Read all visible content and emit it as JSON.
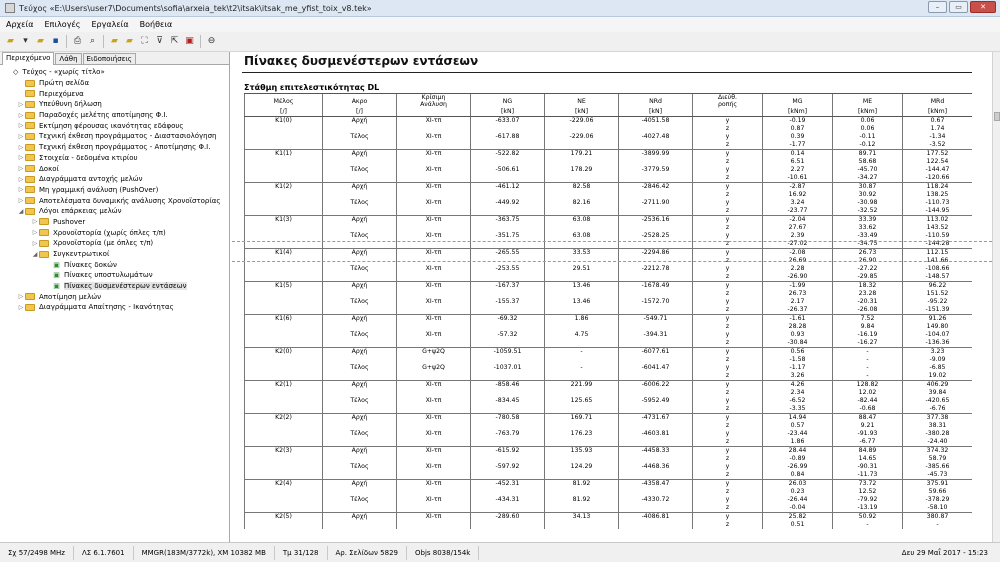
{
  "title": "Τεύχος «E:\\Users\\user7\\Documents\\sofia\\arxeia_tek\\t2\\itsak\\itsak_me_yfist_toix_v8.tek»",
  "menu": [
    "Αρχεία",
    "Επιλογές",
    "Εργαλεία",
    "Βοήθεια"
  ],
  "tabs": [
    "Περιεχόμενο",
    "Λάθη",
    "Ειδοποιήσεις"
  ],
  "tree": [
    {
      "label": "Τεύχος - «χωρίς τίτλο»",
      "icon": "diamond-icon",
      "depth": 0,
      "arrow": ""
    },
    {
      "label": "Πρώτη σελίδα",
      "icon": "folder-icon",
      "depth": 1,
      "arrow": ""
    },
    {
      "label": "Περιεχόμενα",
      "icon": "folder-icon",
      "depth": 1,
      "arrow": ""
    },
    {
      "label": "Υπεύθυνη δήλωση",
      "icon": "folder-icon",
      "depth": 1,
      "arrow": "▷"
    },
    {
      "label": "Παραδοχές μελέτης αποτίμησης Φ.Ι.",
      "icon": "folder-icon",
      "depth": 1,
      "arrow": "▷"
    },
    {
      "label": "Εκτίμηση φέρουσας ικανότητας εδάφους",
      "icon": "folder-icon",
      "depth": 1,
      "arrow": "▷"
    },
    {
      "label": "Τεχνική έκθεση προγράμματος - Διαστασιολόγηση",
      "icon": "folder-icon",
      "depth": 1,
      "arrow": "▷"
    },
    {
      "label": "Τεχνική έκθεση προγράμματος - Αποτίμησης Φ.Ι.",
      "icon": "folder-icon",
      "depth": 1,
      "arrow": "▷"
    },
    {
      "label": "Στοιχεία - δεδομένα κτιρίου",
      "icon": "folder-icon",
      "depth": 1,
      "arrow": "▷"
    },
    {
      "label": "Δοκοί",
      "icon": "folder-icon",
      "depth": 1,
      "arrow": "▷"
    },
    {
      "label": "Διαγράμματα αντοχής μελών",
      "icon": "folder-icon",
      "depth": 1,
      "arrow": "▷"
    },
    {
      "label": "Μη γραμμική ανάλυση (PushOver)",
      "icon": "folder-icon",
      "depth": 1,
      "arrow": "▷"
    },
    {
      "label": "Αποτελέσματα δυναμικής ανάλυσης Χρονοϊστορίας",
      "icon": "folder-icon",
      "depth": 1,
      "arrow": "▷"
    },
    {
      "label": "Λόγοι επάρκειας μελών",
      "icon": "folder-icon",
      "depth": 1,
      "arrow": "◢"
    },
    {
      "label": "Pushover",
      "icon": "folder-icon",
      "depth": 2,
      "arrow": "▷"
    },
    {
      "label": "Χρονοϊστορία (χωρίς όπλες τ/π)",
      "icon": "folder-icon",
      "depth": 2,
      "arrow": "▷"
    },
    {
      "label": "Χρονοϊστορία (με όπλες τ/π)",
      "icon": "folder-icon",
      "depth": 2,
      "arrow": "▷"
    },
    {
      "label": "Συγκεντρωτικοί",
      "icon": "folder-icon",
      "depth": 2,
      "arrow": "◢"
    },
    {
      "label": "Πίνακες δοκών",
      "icon": "page-icon",
      "depth": 3,
      "arrow": ""
    },
    {
      "label": "Πίνακες υποστυλωμάτων",
      "icon": "page-icon",
      "depth": 3,
      "arrow": ""
    },
    {
      "label": "Πίνακες δυσμενέστερων εντάσεων",
      "icon": "page-icon",
      "depth": 3,
      "arrow": "",
      "selected": true
    },
    {
      "label": "Αποτίμηση μελών",
      "icon": "folder-icon",
      "depth": 1,
      "arrow": "▷"
    },
    {
      "label": "Διαγράμματα Απαίτησης - Ικανότητας",
      "icon": "folder-icon",
      "depth": 1,
      "arrow": "▷"
    }
  ],
  "page": {
    "title": "Πίνακες δυσμενέστερων εντάσεων",
    "subtitle": "Στάθμη επιτελεστικότητας DL"
  },
  "table": {
    "headers": [
      "Μέλος",
      "Ακρο",
      "Κρίσιμη\nΑνάλυση",
      "NG",
      "NE",
      "NRd",
      "Διεύθ.\nροπής",
      "MG",
      "ME",
      "MRd"
    ],
    "units": [
      "[/]",
      "[/]",
      "",
      "[kN]",
      "[kN]",
      "[kN]",
      "",
      "[kNm]",
      "[kNm]",
      "[kNm]"
    ],
    "groups": [
      {
        "m": "K1(0)",
        "r": [
          [
            "Αρχή",
            "XI-τπ",
            "-633.07",
            "-229.06",
            "-4051.58"
          ],
          [
            "Τέλος",
            "XI-τπ",
            "-617.88",
            "-229.06",
            "-4027.48"
          ]
        ],
        "d": [
          [
            "y",
            "-0.19",
            "0.06",
            "0.67"
          ],
          [
            "z",
            "0.87",
            "0.06",
            "1.74"
          ],
          [
            "y",
            "0.39",
            "-0.11",
            "-1.34"
          ],
          [
            "z",
            "-1.77",
            "-0.12",
            "-3.52"
          ]
        ]
      },
      {
        "m": "K1(1)",
        "r": [
          [
            "Αρχή",
            "XI-τπ",
            "-522.82",
            "179.21",
            "-3899.99"
          ],
          [
            "Τέλος",
            "XI-τπ",
            "-506.61",
            "178.29",
            "-3779.59"
          ]
        ],
        "d": [
          [
            "y",
            "0.14",
            "89.71",
            "177.52"
          ],
          [
            "z",
            "6.51",
            "58.68",
            "122.54"
          ],
          [
            "y",
            "2.27",
            "-45.70",
            "-144.47"
          ],
          [
            "z",
            "-10.61",
            "-34.27",
            "-120.66"
          ]
        ]
      },
      {
        "m": "K1(2)",
        "r": [
          [
            "Αρχή",
            "XI-τπ",
            "-461.12",
            "82.58",
            "-2846.42"
          ],
          [
            "Τέλος",
            "XI-τπ",
            "-449.92",
            "82.16",
            "-2711.90"
          ]
        ],
        "d": [
          [
            "y",
            "-2.87",
            "30.87",
            "118.24"
          ],
          [
            "z",
            "16.92",
            "30.92",
            "138.25"
          ],
          [
            "y",
            "3.24",
            "-30.98",
            "-110.73"
          ],
          [
            "z",
            "-23.77",
            "-32.52",
            "-144.95"
          ]
        ]
      },
      {
        "m": "K1(3)",
        "r": [
          [
            "Αρχή",
            "XI-τπ",
            "-363.75",
            "63.08",
            "-2536.16"
          ],
          [
            "Τέλος",
            "XI-τπ",
            "-351.75",
            "63.08",
            "-2528.25"
          ]
        ],
        "d": [
          [
            "y",
            "-2.04",
            "33.39",
            "113.02"
          ],
          [
            "z",
            "27.67",
            "33.62",
            "143.52"
          ],
          [
            "y",
            "2.39",
            "-33.49",
            "-110.59"
          ],
          [
            "z",
            "-27.02",
            "-34.75",
            "-144.28"
          ]
        ]
      },
      {
        "m": "K1(4)",
        "r": [
          [
            "Αρχή",
            "XI-τπ",
            "-265.55",
            "33.53",
            "-2294.86"
          ],
          [
            "Τέλος",
            "XI-τπ",
            "-253.55",
            "29.51",
            "-2212.78"
          ]
        ],
        "d": [
          [
            "y",
            "-2.08",
            "26.73",
            "112.15"
          ],
          [
            "z",
            "26.69",
            "26.90",
            "141.66"
          ],
          [
            "y",
            "2.28",
            "-27.22",
            "-108.66"
          ],
          [
            "z",
            "-26.90",
            "-29.85",
            "-148.57"
          ]
        ]
      },
      {
        "m": "K1(5)",
        "r": [
          [
            "Αρχή",
            "XI-τπ",
            "-167.37",
            "13.46",
            "-1678.49"
          ],
          [
            "Τέλος",
            "XI-τπ",
            "-155.37",
            "13.46",
            "-1572.70"
          ]
        ],
        "d": [
          [
            "y",
            "-1.99",
            "18.32",
            "96.22"
          ],
          [
            "z",
            "26.73",
            "23.28",
            "151.52"
          ],
          [
            "y",
            "2.17",
            "-20.31",
            "-95.22"
          ],
          [
            "z",
            "-26.37",
            "-26.08",
            "-151.39"
          ]
        ]
      },
      {
        "m": "K1(6)",
        "r": [
          [
            "Αρχή",
            "XI-τπ",
            "-69.32",
            "1.86",
            "-549.71"
          ],
          [
            "Τέλος",
            "XI-τπ",
            "-57.32",
            "4.75",
            "-394.31"
          ]
        ],
        "d": [
          [
            "y",
            "-1.61",
            "7.52",
            "91.26"
          ],
          [
            "z",
            "28.28",
            "9.84",
            "149.80"
          ],
          [
            "y",
            "0.93",
            "-16.19",
            "-104.07"
          ],
          [
            "z",
            "-30.84",
            "-16.27",
            "-136.36"
          ]
        ]
      },
      {
        "m": "K2(0)",
        "r": [
          [
            "Αρχή",
            "G+ψ2Q",
            "-1059.51",
            "-",
            "-6077.61"
          ],
          [
            "Τέλος",
            "G+ψ2Q",
            "-1037.01",
            "-",
            "-6041.47"
          ]
        ],
        "d": [
          [
            "y",
            "0.56",
            "-",
            "3.23"
          ],
          [
            "z",
            "-1.58",
            "-",
            "-9.09"
          ],
          [
            "y",
            "-1.17",
            "-",
            "-6.85"
          ],
          [
            "z",
            "3.26",
            "-",
            "19.02"
          ]
        ]
      },
      {
        "m": "K2(1)",
        "r": [
          [
            "Αρχή",
            "XI-τπ",
            "-858.46",
            "221.99",
            "-6006.22"
          ],
          [
            "Τέλος",
            "XI-τπ",
            "-834.45",
            "125.65",
            "-5952.49"
          ]
        ],
        "d": [
          [
            "y",
            "4.26",
            "128.82",
            "406.29"
          ],
          [
            "z",
            "2.34",
            "12.02",
            "39.84"
          ],
          [
            "y",
            "-6.52",
            "-82.44",
            "-420.65"
          ],
          [
            "z",
            "-3.35",
            "-0.68",
            "-6.76"
          ]
        ]
      },
      {
        "m": "K2(2)",
        "r": [
          [
            "Αρχή",
            "XI-τπ",
            "-780.58",
            "169.71",
            "-4731.67"
          ],
          [
            "Τέλος",
            "XI-τπ",
            "-763.79",
            "176.23",
            "-4603.81"
          ]
        ],
        "d": [
          [
            "y",
            "14.94",
            "88.47",
            "377.38"
          ],
          [
            "z",
            "0.57",
            "9.21",
            "38.31"
          ],
          [
            "y",
            "-23.44",
            "-91.93",
            "-380.28"
          ],
          [
            "z",
            "1.86",
            "-6.77",
            "-24.40"
          ]
        ]
      },
      {
        "m": "K2(3)",
        "r": [
          [
            "Αρχή",
            "XI-τπ",
            "-615.92",
            "135.93",
            "-4458.33"
          ],
          [
            "Τέλος",
            "XI-τπ",
            "-597.92",
            "124.29",
            "-4468.36"
          ]
        ],
        "d": [
          [
            "y",
            "28.44",
            "84.89",
            "374.32"
          ],
          [
            "z",
            "-0.89",
            "14.65",
            "58.79"
          ],
          [
            "y",
            "-26.99",
            "-90.31",
            "-385.66"
          ],
          [
            "z",
            "0.84",
            "-11.73",
            "-45.73"
          ]
        ]
      },
      {
        "m": "K2(4)",
        "r": [
          [
            "Αρχή",
            "XI-τπ",
            "-452.31",
            "81.92",
            "-4358.47"
          ],
          [
            "Τέλος",
            "XI-τπ",
            "-434.31",
            "81.92",
            "-4330.72"
          ]
        ],
        "d": [
          [
            "y",
            "26.03",
            "73.72",
            "375.91"
          ],
          [
            "z",
            "0.23",
            "12.52",
            "59.66"
          ],
          [
            "y",
            "-26.44",
            "-79.92",
            "-378.29"
          ],
          [
            "z",
            "-0.04",
            "-13.19",
            "-58.10"
          ]
        ]
      },
      {
        "m": "K2(5)",
        "r": [
          [
            "Αρχή",
            "XI-τπ",
            "-289.60",
            "34.13",
            "-4086.81"
          ]
        ],
        "d": [
          [
            "y",
            "25.82",
            "50.92",
            "380.87"
          ],
          [
            "z",
            "0.51",
            "-",
            "-"
          ]
        ]
      }
    ]
  },
  "status": [
    "Σχ 57/2498 MHz",
    "ΛΣ 6.1.7601",
    "MMGR(183M/3772k), XM 10382 MB",
    "Τμ 31/128",
    "Αρ. Σελίδων 5829",
    "Objs 8038/154k"
  ],
  "status_date": "Δευ 29 Μαΐ 2017 - 15:23"
}
